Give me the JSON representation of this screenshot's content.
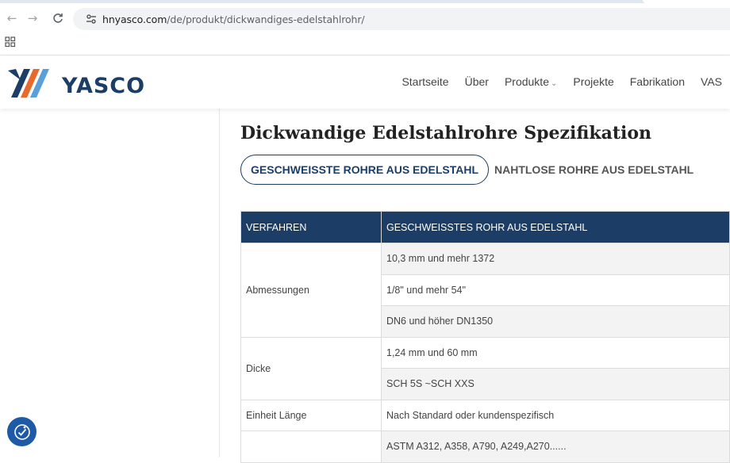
{
  "browser": {
    "url_domain": "hnyasco.com",
    "url_path": "/de/produkt/dickwandiges-edelstahlrohr/",
    "back_icon": "arrow-left-icon",
    "forward_icon": "arrow-right-icon",
    "reload_icon": "reload-icon"
  },
  "header": {
    "logo_text": "YASCO",
    "nav": [
      {
        "label": "Startseite"
      },
      {
        "label": "Über"
      },
      {
        "label": "Produkte",
        "has_dropdown": true
      },
      {
        "label": "Projekte"
      },
      {
        "label": "Fabrikation"
      },
      {
        "label": "VAS"
      }
    ],
    "colors": {
      "brand_blue": "#1c3e66",
      "brand_orange": "#e8692a",
      "brand_light_blue": "#5aa0d8"
    }
  },
  "main": {
    "title": "Dickwandige Edelstahlrohre Spezifikation",
    "tabs": [
      {
        "label": "GESCHWEISSTE ROHRE AUS EDELSTAHL",
        "active": true
      },
      {
        "label": "NAHTLOSE ROHRE AUS EDELSTAHL",
        "active": false
      }
    ],
    "table": {
      "headers": [
        "VERFAHREN",
        "GESCHWEISSTES ROHR AUS EDELSTAHL"
      ],
      "groups": [
        {
          "label": "Abmessungen",
          "values": [
            "10,3 mm und mehr 1372",
            "1/8\" und mehr 54\"",
            "DN6 und höher DN1350"
          ]
        },
        {
          "label": "Dicke",
          "values": [
            "1,24 mm und 60 mm",
            "SCH 5S ~SCH XXS"
          ]
        },
        {
          "label": "Einheit Länge",
          "values": [
            "Nach Standard oder kundenspezifisch"
          ]
        },
        {
          "label": "",
          "values": [
            "ASTM A312, A358, A790, A249,A270......"
          ]
        }
      ]
    }
  },
  "accessibility_button": {
    "icon": "accessibility-icon"
  }
}
